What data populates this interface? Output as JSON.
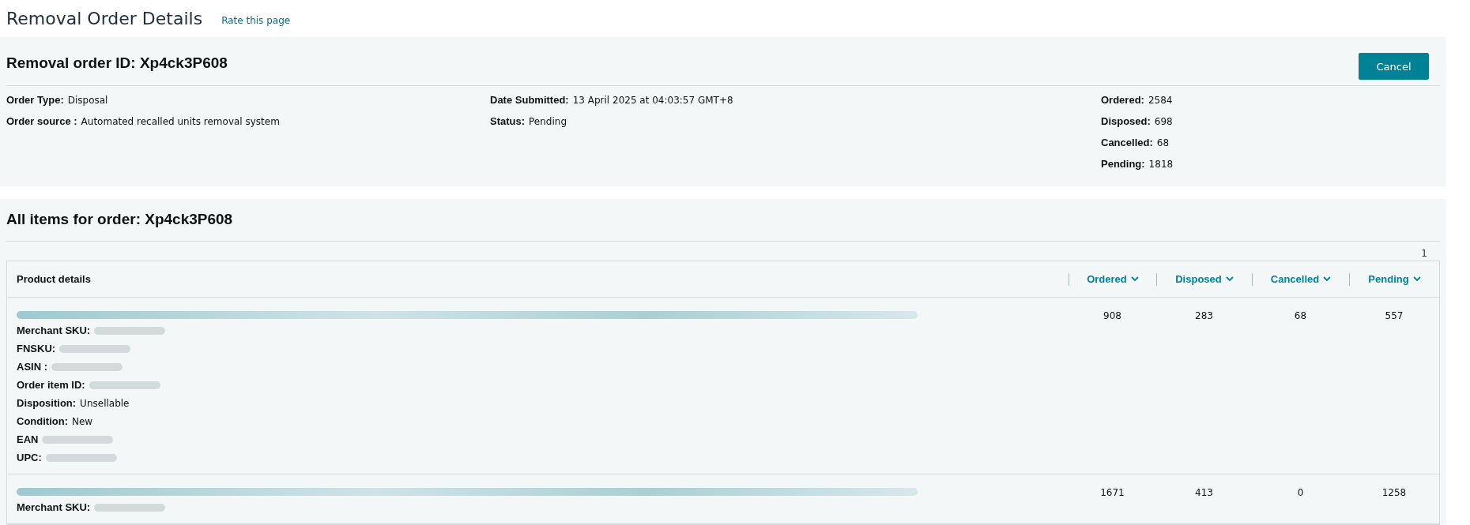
{
  "page": {
    "title": "Removal Order Details",
    "rate_link": "Rate this page"
  },
  "order": {
    "heading": "Removal order ID: Xp4ck3P608",
    "cancel_button": "Cancel",
    "columns": [
      [
        {
          "label": "Order Type:",
          "value": "Disposal"
        },
        {
          "label": "Order source :",
          "value": "Automated recalled units removal system"
        }
      ],
      [
        {
          "label": "Date Submitted:",
          "value": "13 April 2025 at 04:03:57 GMT+8"
        },
        {
          "label": "Status:",
          "value": "Pending"
        }
      ],
      [
        {
          "label": "Ordered:",
          "value": "2584"
        },
        {
          "label": "Disposed:",
          "value": "698"
        },
        {
          "label": "Cancelled:",
          "value": "68"
        },
        {
          "label": "Pending:",
          "value": "1818"
        }
      ]
    ]
  },
  "items": {
    "heading": "All items for order: Xp4ck3P608",
    "page_number": "1",
    "columns": [
      {
        "label": "Product details",
        "sortable": false
      },
      {
        "label": "Ordered",
        "sortable": true
      },
      {
        "label": "Disposed",
        "sortable": true
      },
      {
        "label": "Cancelled",
        "sortable": true
      },
      {
        "label": "Pending",
        "sortable": true
      }
    ],
    "rows": [
      {
        "details": [
          {
            "label": "Merchant SKU:",
            "redacted": true
          },
          {
            "label": "FNSKU:",
            "redacted": true
          },
          {
            "label": "ASIN :",
            "redacted": true
          },
          {
            "label": "Order item ID:",
            "redacted": true
          },
          {
            "label": "Disposition:",
            "value": "Unsellable",
            "redacted": false
          },
          {
            "label": "Condition:",
            "value": "New",
            "redacted": false
          },
          {
            "label": "EAN",
            "redacted": true
          },
          {
            "label": "UPC:",
            "redacted": true
          }
        ],
        "ordered": "908",
        "disposed": "283",
        "cancelled": "68",
        "pending": "557"
      },
      {
        "details": [
          {
            "label": "Merchant SKU:",
            "redacted": true
          }
        ],
        "ordered": "1671",
        "disposed": "413",
        "cancelled": "0",
        "pending": "1258"
      }
    ]
  }
}
